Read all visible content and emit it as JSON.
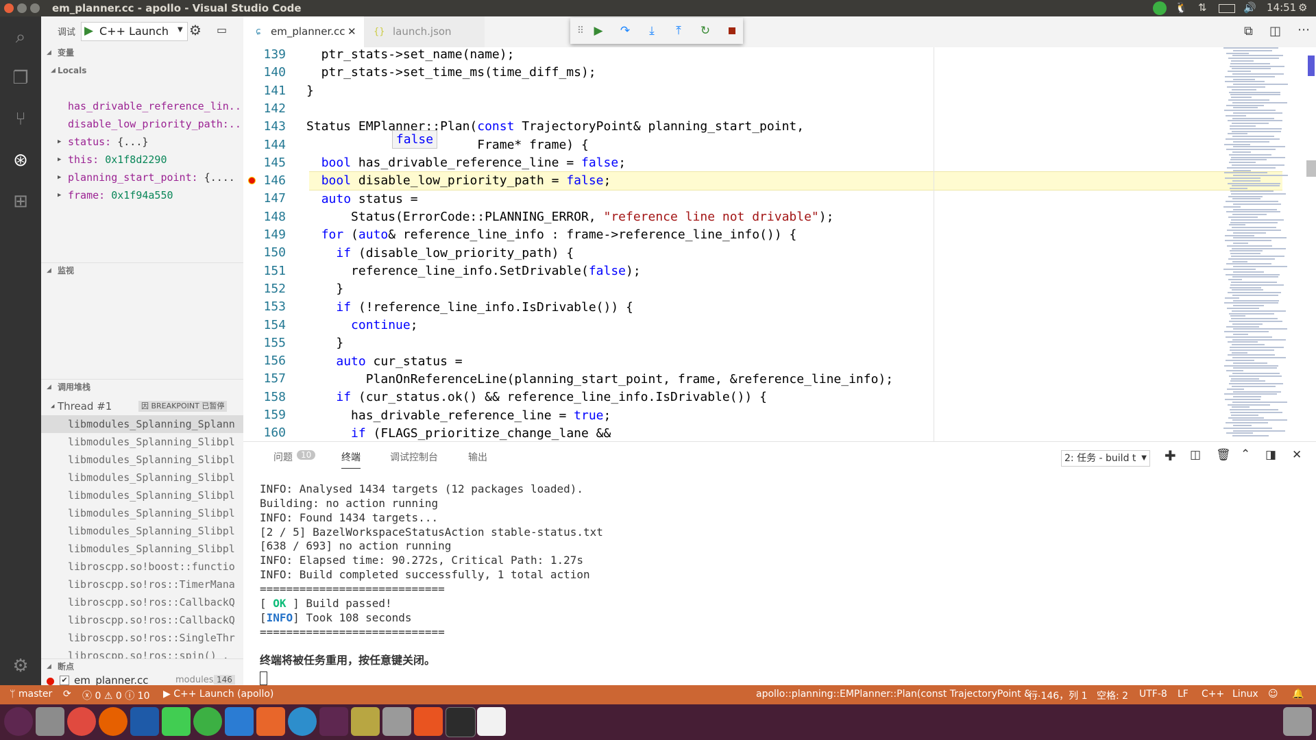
{
  "window": {
    "title": "em_planner.cc - apollo - Visual Studio Code",
    "clock": "14:51"
  },
  "debug": {
    "label": "调试",
    "config": "C++ Launch"
  },
  "sections": {
    "variables": "变量",
    "locals": "Locals",
    "watch": "监视",
    "callstack": "调用堆栈",
    "breakpoints": "断点"
  },
  "locals": [
    {
      "name": "has_drivable_reference_lin...",
      "value": ""
    },
    {
      "name": "disable_low_priority_path:...",
      "value": ""
    },
    {
      "name": "status:",
      "value": "{...}"
    },
    {
      "name": "this:",
      "value": "0x1f8d2290"
    },
    {
      "name": "planning_start_point:",
      "value": "{...."
    },
    {
      "name": "frame:",
      "value": "0x1f94a550"
    }
  ],
  "thread": {
    "label": "Thread #1",
    "badge": "因 BREAKPOINT 已暂停"
  },
  "stack": [
    "libmodules_Splanning_Splann",
    "libmodules_Splanning_Slibpl",
    "libmodules_Splanning_Slibpl",
    "libmodules_Splanning_Slibpl",
    "libmodules_Splanning_Slibpl",
    "libmodules_Splanning_Slibpl",
    "libmodules_Splanning_Slibpl",
    "libmodules_Splanning_Slibpl",
    "libroscpp.so!boost::functio",
    "libroscpp.so!ros::TimerMana",
    "libroscpp.so!ros::CallbackQ",
    "libroscpp.so!ros::CallbackQ",
    "libroscpp.so!ros::SingleThr",
    "libroscpp.so!ros::spin() ."
  ],
  "breakpoint": {
    "file": "em_planner.cc",
    "path": "modules/p...",
    "line": "146"
  },
  "tabs": {
    "active": "em_planner.cc",
    "other": "launch.json"
  },
  "editor": {
    "lines": [
      "139",
      "140",
      "141",
      "142",
      "143",
      "144",
      "145",
      "146",
      "147",
      "148",
      "149",
      "150",
      "151",
      "152",
      "153",
      "154",
      "155",
      "156",
      "157",
      "158",
      "159",
      "160"
    ],
    "hover": "false"
  },
  "panel": {
    "tabs": {
      "problems": "问题",
      "problems_count": "10",
      "terminal": "终端",
      "debug_console": "调试控制台",
      "output": "输出"
    },
    "task_select": "2: 任务 - build t",
    "terminal": [
      "INFO: Analysed 1434 targets (12 packages loaded).",
      "Building: no action running",
      "INFO: Found 1434 targets...",
      "[2 / 5] BazelWorkspaceStatusAction stable-status.txt",
      "[638 / 693] no action running",
      "INFO: Elapsed time: 90.272s, Critical Path: 1.27s",
      "INFO: Build completed successfully, 1 total action",
      "============================",
      "[ OK ] Build passed!",
      "[INFO] Took 108 seconds",
      "============================",
      "",
      "终端将被任务重用，按任意键关闭。"
    ]
  },
  "status": {
    "branch": "master",
    "errors": "0",
    "warnings": "0",
    "infos": "10",
    "launch": "C++ Launch (apollo)",
    "func": "apollo::planning::EMPlanner::Plan(const TrajectoryPoint &...",
    "pos": "行 146，列 1",
    "spaces": "空格: 2",
    "enc": "UTF-8",
    "eol": "LF",
    "lang": "C++",
    "os": "Linux"
  },
  "colors": {
    "statusbar": "#cc6633",
    "activity": "#333333",
    "dock": "#461e35"
  }
}
